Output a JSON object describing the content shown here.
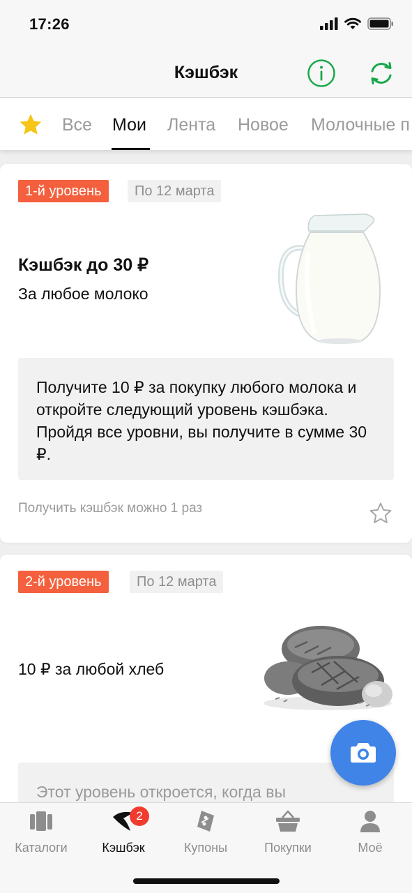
{
  "status_bar": {
    "time": "17:26"
  },
  "header": {
    "title": "Кэшбэк"
  },
  "tabs": [
    {
      "label": "Все"
    },
    {
      "label": "Мои"
    },
    {
      "label": "Лента"
    },
    {
      "label": "Новое"
    },
    {
      "label": "Молочные п"
    }
  ],
  "active_tab": "Мои",
  "cards": [
    {
      "level": "1-й уровень",
      "date": "По 12 марта",
      "title": "Кэшбэк до 30 ₽",
      "subtitle": "За любое молоко",
      "description": "Получите 10 ₽ за покупку любого молока и откройте следующий уровень кэшбэка. Пройдя все уровни, вы получите в сумме 30 ₽.",
      "note": "Получить кэшбэк можно 1 раз",
      "image": "milk-jug"
    },
    {
      "level": "2-й уровень",
      "date": "По 12 марта",
      "title": "10 ₽ за любой хлеб",
      "description": "Этот уровень откроется, когда вы",
      "image": "bread"
    }
  ],
  "bottom_nav": [
    {
      "label": "Каталоги",
      "icon": "catalog-icon"
    },
    {
      "label": "Кэшбэк",
      "icon": "cashback-icon",
      "badge": "2"
    },
    {
      "label": "Купоны",
      "icon": "coupon-icon"
    },
    {
      "label": "Покупки",
      "icon": "basket-icon"
    },
    {
      "label": "Моё",
      "icon": "profile-icon"
    }
  ],
  "active_nav": "Кэшбэк",
  "colors": {
    "accent_green": "#1aa84b",
    "badge_orange": "#f4603d",
    "fab_blue": "#3f84e6",
    "star_yellow": "#f5c518",
    "nav_badge_red": "#f23b2f"
  }
}
